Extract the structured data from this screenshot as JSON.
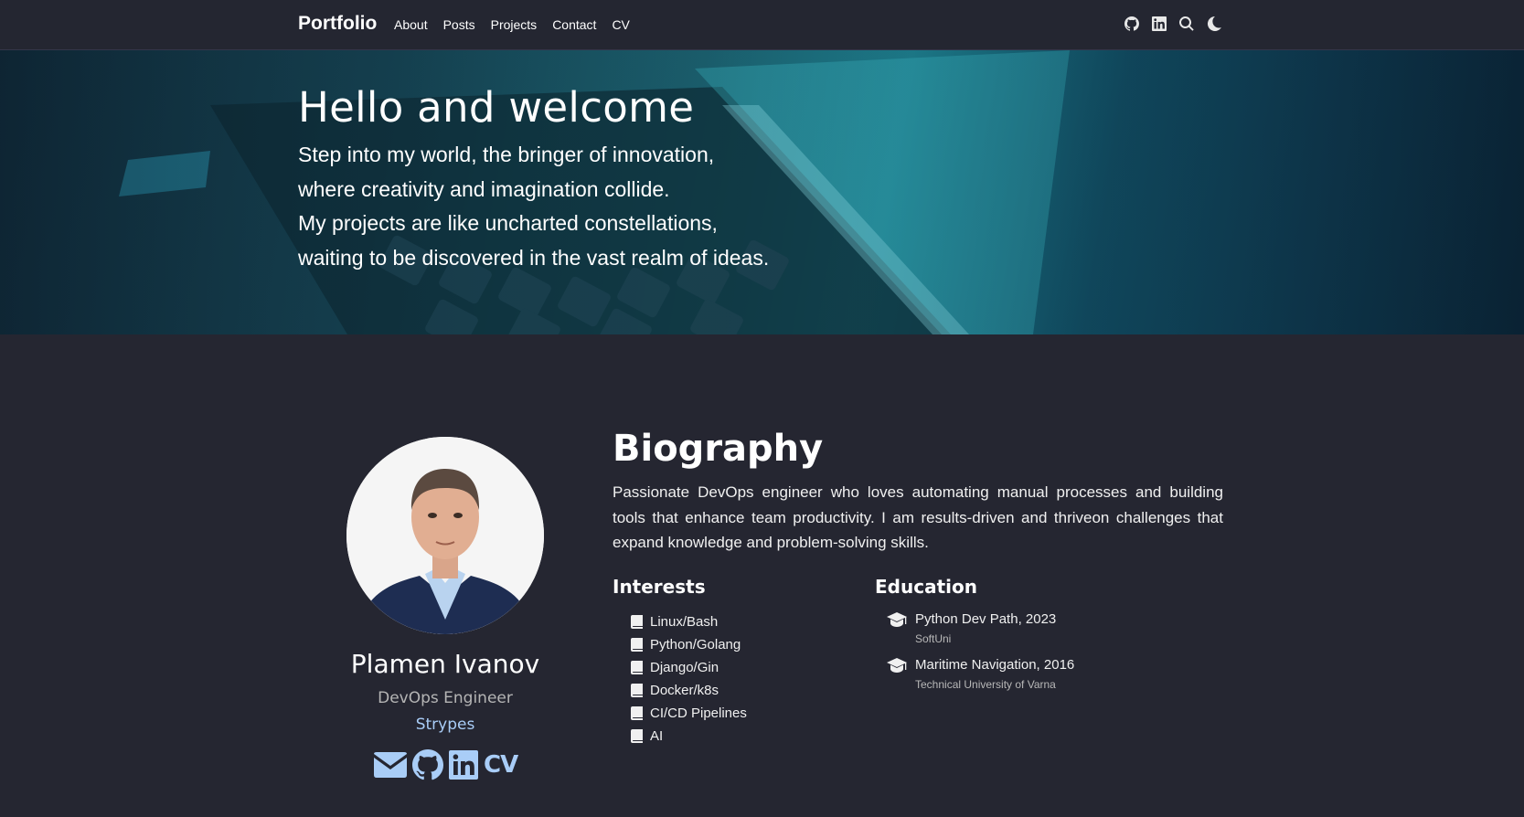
{
  "navbar": {
    "brand": "Portfolio",
    "links": [
      "About",
      "Posts",
      "Projects",
      "Contact",
      "CV"
    ],
    "icons": [
      "github-icon",
      "linkedin-icon",
      "search-icon",
      "moon-icon"
    ]
  },
  "hero": {
    "title": "Hello and welcome",
    "lines": [
      "Step into my world, the bringer of innovation,",
      "where creativity and imagination collide.",
      "My projects are like uncharted constellations,",
      "waiting to be discovered in the vast realm of ideas."
    ]
  },
  "profile": {
    "name": "Plamen Ivanov",
    "role": "DevOps Engineer",
    "organization": "Strypes",
    "social": {
      "icons": [
        "envelope-icon",
        "github-icon",
        "linkedin-icon"
      ],
      "cv_label": "CV"
    }
  },
  "biography": {
    "title": "Biography",
    "text": "Passionate DevOps engineer who loves automating manual processes and building tools that enhance team productivity. I am results-driven and thriveon challenges that expand knowledge and problem-solving skills."
  },
  "interests": {
    "title": "Interests",
    "items": [
      "Linux/Bash",
      "Python/Golang",
      "Django/Gin",
      "Docker/k8s",
      "CI/CD Pipelines",
      "AI"
    ]
  },
  "education": {
    "title": "Education",
    "items": [
      {
        "degree": "Python Dev Path, 2023",
        "institution": "SoftUni"
      },
      {
        "degree": "Maritime Navigation, 2016",
        "institution": "Technical University of Varna"
      }
    ]
  },
  "colors": {
    "background": "#252631",
    "accent": "#a9cdf7",
    "hero_teal": "#1c7685"
  }
}
